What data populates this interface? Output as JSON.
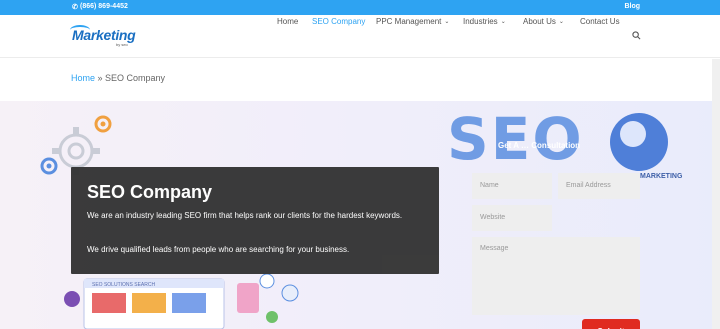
{
  "topbar": {
    "phone": "(866) 869-4452",
    "blog": "Blog"
  },
  "logo": {
    "word": "Marketing",
    "sub": "by seo"
  },
  "nav": {
    "items": [
      {
        "label": "Home",
        "dropdown": false,
        "active": false
      },
      {
        "label": "SEO Company",
        "dropdown": false,
        "active": true
      },
      {
        "label": "PPC Management",
        "dropdown": true,
        "active": false
      },
      {
        "label": "Industries",
        "dropdown": true,
        "active": false
      },
      {
        "label": "About Us",
        "dropdown": true,
        "active": false
      },
      {
        "label": "Contact Us",
        "dropdown": false,
        "active": false
      }
    ],
    "search_icon": "search-icon"
  },
  "breadcrumb": {
    "home": "Home",
    "separator": " » ",
    "current": "SEO Company"
  },
  "hero": {
    "bg_text": "SEO",
    "bg_text_suffix": "MARKETING",
    "consult_heading": "Get A … Consultation",
    "card": {
      "title": "SEO Company",
      "p1": "We are an industry leading SEO firm that helps rank our clients for the hardest keywords.",
      "p2": "We drive qualified leads from people who are searching for your business."
    },
    "illustration_text": "SEO SOLUTIONS SEARCH",
    "form": {
      "name_placeholder": "Name",
      "email_placeholder": "Email Address",
      "website_placeholder": "Website",
      "message_placeholder": "Message",
      "submit_label": "Submit"
    }
  },
  "colors": {
    "accent": "#2ea3f2",
    "card": "#353535",
    "submit": "#e02b20"
  }
}
